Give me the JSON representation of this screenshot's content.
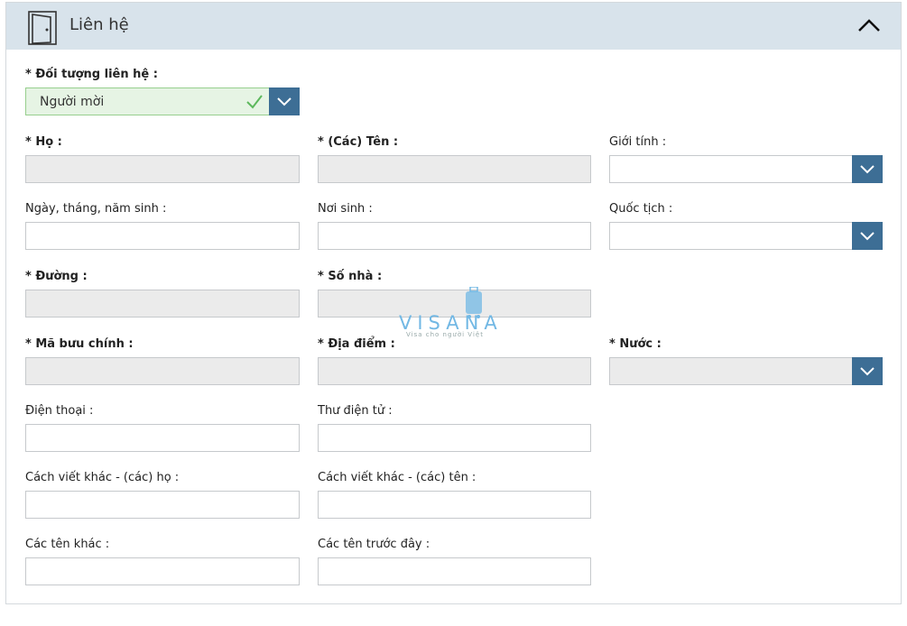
{
  "header": {
    "title": "Liên hệ"
  },
  "contact_type": {
    "label": "* Đối tượng liên hệ :",
    "value": "Người mời"
  },
  "fields": {
    "surname": {
      "label": "* Họ :"
    },
    "given_names": {
      "label": "* (Các) Tên :"
    },
    "gender": {
      "label": "Giới tính :"
    },
    "birth_date": {
      "label": "Ngày, tháng, năm sinh :"
    },
    "birth_place": {
      "label": "Nơi sinh :"
    },
    "nationality": {
      "label": "Quốc tịch :"
    },
    "street": {
      "label": "* Đường :"
    },
    "house_number": {
      "label": "* Số nhà :"
    },
    "postal_code": {
      "label": "* Mã bưu chính :"
    },
    "locality": {
      "label": "* Địa điểm :"
    },
    "country": {
      "label": "* Nước :"
    },
    "phone": {
      "label": "Điện thoại :"
    },
    "email": {
      "label": "Thư điện tử :"
    },
    "alt_surname": {
      "label": "Cách viết khác - (các) họ :"
    },
    "alt_given_names": {
      "label": "Cách viết khác - (các) tên :"
    },
    "other_names": {
      "label": "Các tên khác :"
    },
    "previous_names": {
      "label": "Các tên trước đây :"
    }
  },
  "watermark": {
    "brand": "VISANA",
    "tagline": "Visa cho người Việt"
  },
  "colors": {
    "header_bg": "#d8e3eb",
    "select_btn": "#3d6e95",
    "selected_bg": "#e6f4e4",
    "check": "#5cb85c",
    "disabled_bg": "#ebebeb"
  }
}
